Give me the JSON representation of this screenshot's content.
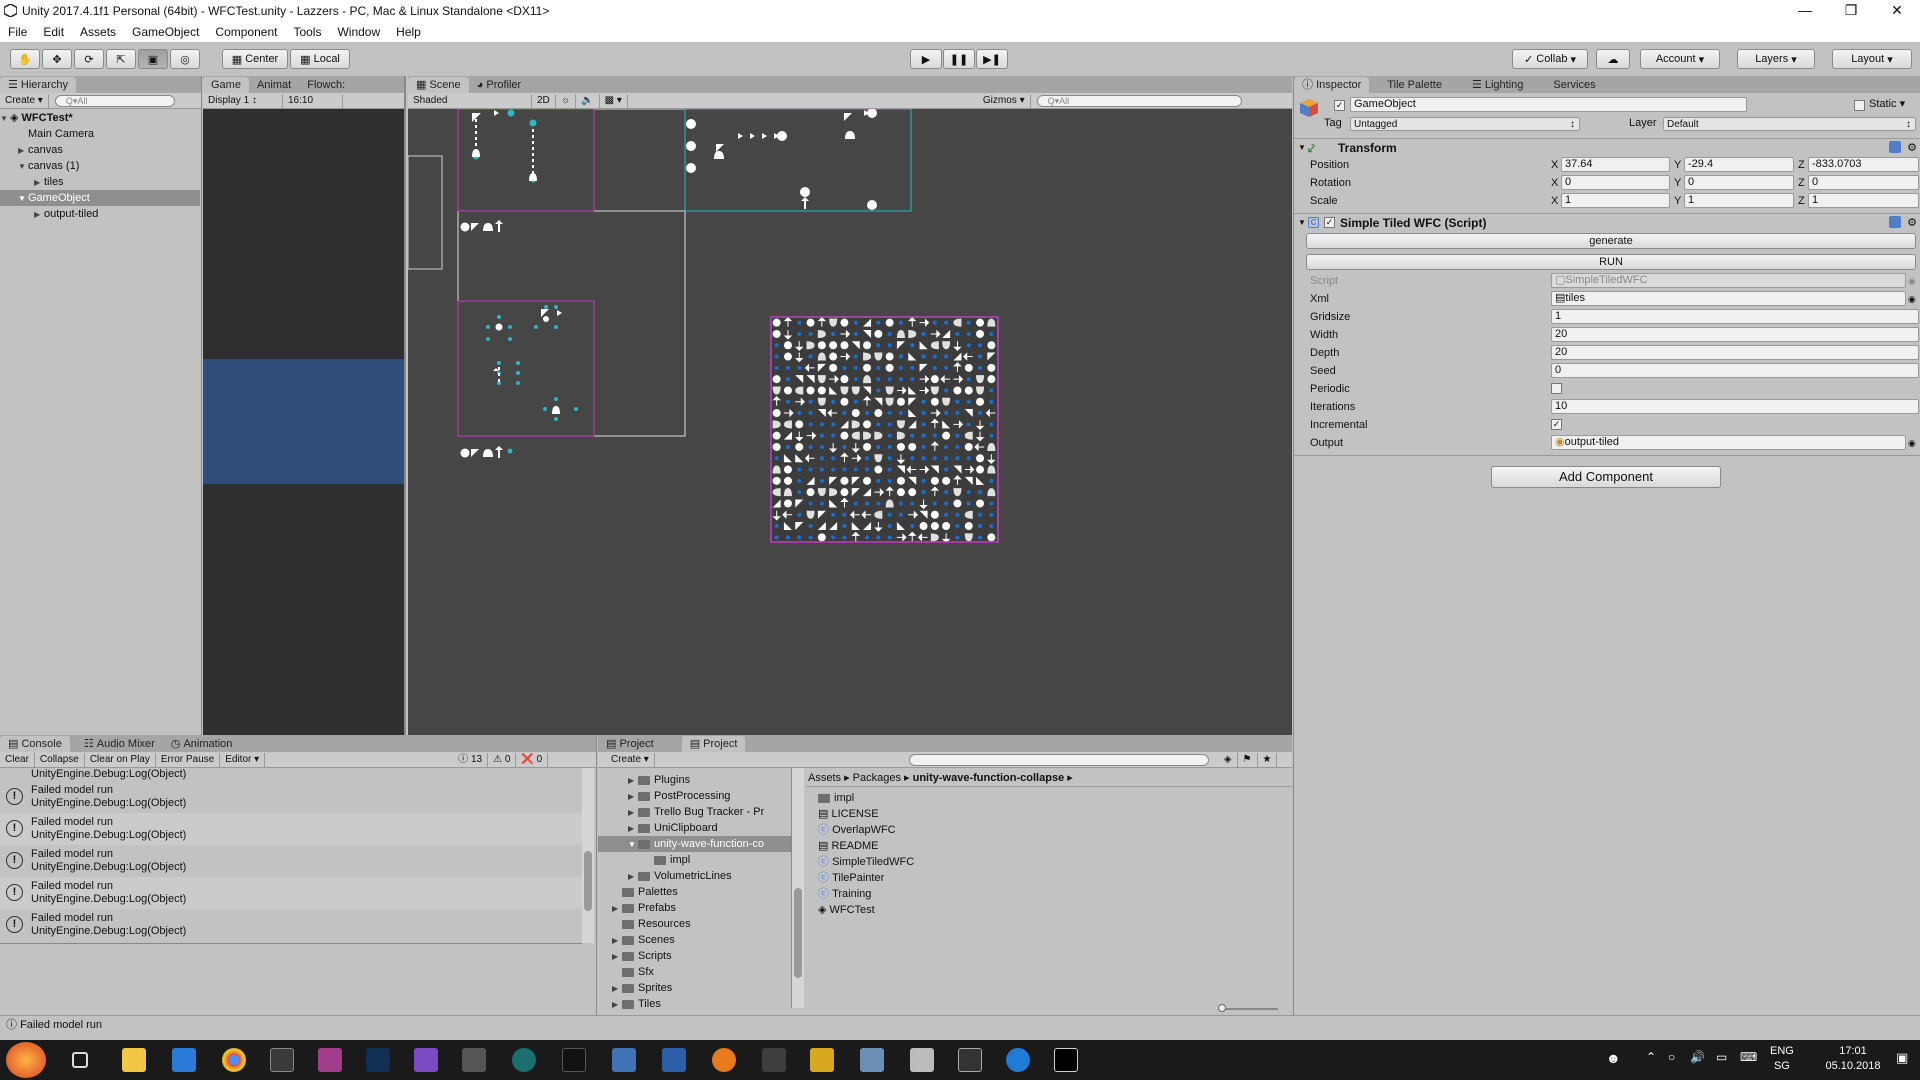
{
  "window": {
    "title": "Unity 2017.4.1f1 Personal (64bit) - WFCTest.unity - Lazzers - PC, Mac & Linux Standalone <DX11>"
  },
  "menu": [
    "File",
    "Edit",
    "Assets",
    "GameObject",
    "Component",
    "Tools",
    "Window",
    "Help"
  ],
  "toolbar": {
    "center_label": "Center",
    "local_label": "Local",
    "collab_label": "Collab",
    "account_label": "Account",
    "layers_label": "Layers",
    "layout_label": "Layout"
  },
  "hierarchy": {
    "tab": "Hierarchy",
    "create_label": "Create",
    "search_placeholder": "Q▾All",
    "scene_name": "WFCTest*",
    "items": [
      {
        "label": "Main Camera"
      },
      {
        "label": "canvas"
      },
      {
        "label": "canvas (1)"
      },
      {
        "label": "tiles"
      },
      {
        "label": "GameObject"
      },
      {
        "label": "output-tiled"
      }
    ]
  },
  "game": {
    "tabs": [
      "Game",
      "Animat",
      "Flowch:"
    ],
    "display_label": "Display 1",
    "aspect_label": "16:10"
  },
  "scene": {
    "tabs": [
      "Scene",
      "Profiler"
    ],
    "shading_label": "Shaded",
    "mode_2d": "2D",
    "gizmos_label": "Gizmos",
    "search_placeholder": "Q▾All"
  },
  "inspector": {
    "tabs": [
      "Inspector",
      "Tile Palette",
      "Lighting",
      "Services"
    ],
    "object_name": "GameObject",
    "static_label": "Static",
    "tag_label": "Tag",
    "tag_value": "Untagged",
    "layer_label": "Layer",
    "layer_value": "Default",
    "transform": {
      "title": "Transform",
      "position_label": "Position",
      "rotation_label": "Rotation",
      "scale_label": "Scale",
      "position": {
        "x": "37.64",
        "y": "-29.4",
        "z": "-833.0703"
      },
      "rotation": {
        "x": "0",
        "y": "0",
        "z": "0"
      },
      "scale": {
        "x": "1",
        "y": "1",
        "z": "1"
      }
    },
    "script_component": {
      "title": "Simple Tiled WFC (Script)",
      "generate_label": "generate",
      "run_label": "RUN",
      "fields": [
        {
          "label": "Script",
          "value": "SimpleTiledWFC"
        },
        {
          "label": "Xml",
          "value": "tiles"
        },
        {
          "label": "Gridsize",
          "value": "1"
        },
        {
          "label": "Width",
          "value": "20"
        },
        {
          "label": "Depth",
          "value": "20"
        },
        {
          "label": "Seed",
          "value": "0"
        },
        {
          "label": "Periodic",
          "value": ""
        },
        {
          "label": "Iterations",
          "value": "10"
        },
        {
          "label": "Incremental",
          "value": ""
        },
        {
          "label": "Output",
          "value": "output-tiled"
        }
      ],
      "periodic_checked": false,
      "incremental_checked": true
    },
    "add_component_label": "Add Component"
  },
  "console": {
    "tabs": [
      "Console",
      "Audio Mixer",
      "Animation"
    ],
    "buttons": [
      "Clear",
      "Collapse",
      "Clear on Play",
      "Error Pause",
      "Editor"
    ],
    "counts": {
      "info": "13",
      "warn": "0",
      "error": "0"
    },
    "top_partial": "UnityEngine.Debug:Log(Object)",
    "entries": [
      {
        "line1": "Failed model run",
        "line2": "UnityEngine.Debug:Log(Object)"
      },
      {
        "line1": "Failed model run",
        "line2": "UnityEngine.Debug:Log(Object)"
      },
      {
        "line1": "Failed model run",
        "line2": "UnityEngine.Debug:Log(Object)"
      },
      {
        "line1": "Failed model run",
        "line2": "UnityEngine.Debug:Log(Object)"
      },
      {
        "line1": "Failed model run",
        "line2": "UnityEngine.Debug:Log(Object)"
      }
    ]
  },
  "project": {
    "tabs": [
      "Project",
      "Project"
    ],
    "create_label": "Create",
    "tree": [
      {
        "label": "Plugins"
      },
      {
        "label": "PostProcessing"
      },
      {
        "label": "Trello Bug Tracker - Pr"
      },
      {
        "label": "UniClipboard"
      },
      {
        "label": "unity-wave-function-co"
      },
      {
        "label": "impl"
      },
      {
        "label": "VolumetricLines"
      },
      {
        "label": "Palettes"
      },
      {
        "label": "Prefabs"
      },
      {
        "label": "Resources"
      },
      {
        "label": "Scenes"
      },
      {
        "label": "Scripts"
      },
      {
        "label": "Sfx"
      },
      {
        "label": "Sprites"
      },
      {
        "label": "Tiles"
      }
    ],
    "breadcrumb": [
      "Assets",
      "Packages",
      "unity-wave-function-collapse"
    ],
    "files": [
      {
        "label": "impl"
      },
      {
        "label": "LICENSE"
      },
      {
        "label": "OverlapWFC"
      },
      {
        "label": "README"
      },
      {
        "label": "SimpleTiledWFC"
      },
      {
        "label": "TilePainter"
      },
      {
        "label": "Training"
      },
      {
        "label": "WFCTest"
      }
    ]
  },
  "status": {
    "message": "Failed model run"
  },
  "taskbar": {
    "lang1": "ENG",
    "lang2": "SG",
    "time": "17:01",
    "date": "05.10.2018"
  },
  "colors": {
    "editor_bg": "#c2c2c2",
    "scene_bg": "#464646",
    "magenta": "#c23fc2",
    "cyan": "#2fb5c6",
    "tile_blue": "#1a6fd0"
  }
}
